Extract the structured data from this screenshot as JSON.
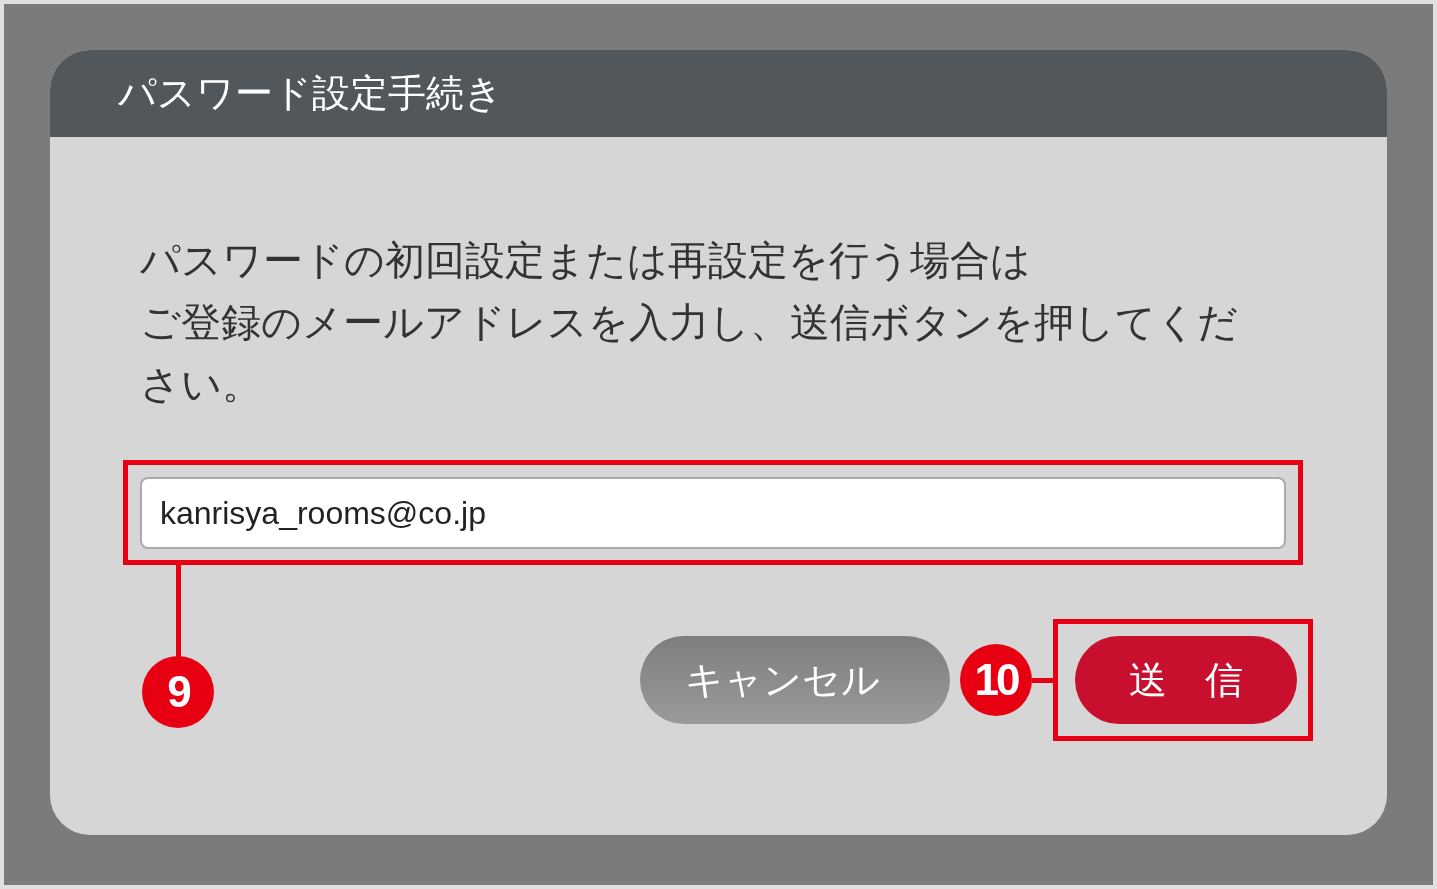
{
  "dialog": {
    "title": "パスワード設定手続き",
    "message_lines": [
      "パスワードの初回設定または再設定を行う場合は",
      "ご登録のメールアドレスを入力し、送信ボタンを押してください。"
    ],
    "email_field": {
      "value": "kanrisya_rooms@co.jp"
    },
    "buttons": [
      {
        "label": "キャンセル",
        "kind": "secondary"
      },
      {
        "label": "送　信",
        "kind": "primary"
      }
    ]
  },
  "callouts": [
    {
      "number": "9"
    },
    {
      "number": "10"
    }
  ]
}
